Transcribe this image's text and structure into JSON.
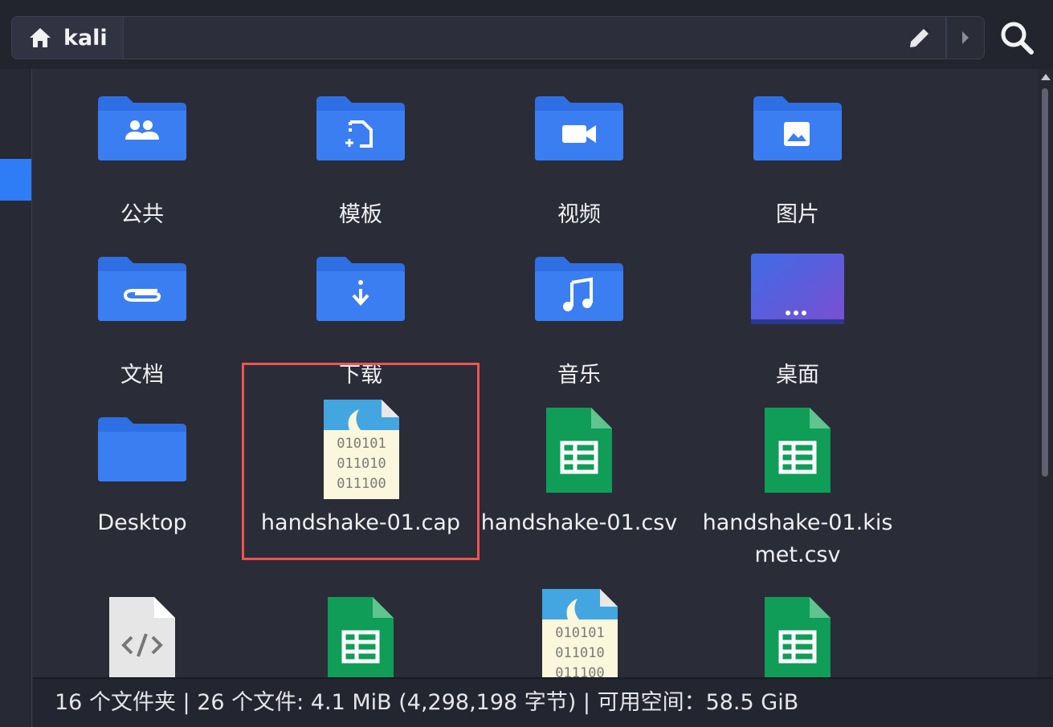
{
  "toolbar": {
    "home_label": "kali",
    "path_value": ""
  },
  "grid": {
    "items": [
      {
        "name": "公共",
        "icon": "folder-public-icon"
      },
      {
        "name": "模板",
        "icon": "folder-templates-icon"
      },
      {
        "name": "视频",
        "icon": "folder-videos-icon"
      },
      {
        "name": "图片",
        "icon": "folder-pictures-icon"
      },
      {
        "name": "文档",
        "icon": "folder-documents-icon"
      },
      {
        "name": "下载",
        "icon": "folder-downloads-icon"
      },
      {
        "name": "音乐",
        "icon": "folder-music-icon"
      },
      {
        "name": "桌面",
        "icon": "desktop-folder-icon"
      },
      {
        "name": "Desktop",
        "icon": "folder-icon"
      },
      {
        "name": "handshake-01.cap",
        "icon": "binary-file-icon",
        "selected": true
      },
      {
        "name": "handshake-01.csv",
        "icon": "spreadsheet-file-icon"
      },
      {
        "name": "handshake-01.kismet.csv",
        "icon": "spreadsheet-file-icon"
      },
      {
        "name": "",
        "icon": "code-file-icon"
      },
      {
        "name": "",
        "icon": "spreadsheet-file-icon"
      },
      {
        "name": "",
        "icon": "binary-file-icon"
      },
      {
        "name": "",
        "icon": "spreadsheet-file-icon"
      }
    ],
    "binary_lines": [
      "010101",
      "011010",
      "011100"
    ]
  },
  "status": {
    "text": "16 个文件夹 | 26 个文件: 4.1 MiB (4,298,198 字节) | 可用空间：58.5 GiB"
  },
  "colors": {
    "folder": "#2f6fe4",
    "folder_light": "#3f86f4",
    "sheet": "#0f9d58",
    "accent": "#2f7df6",
    "selection": "#ef5350"
  }
}
